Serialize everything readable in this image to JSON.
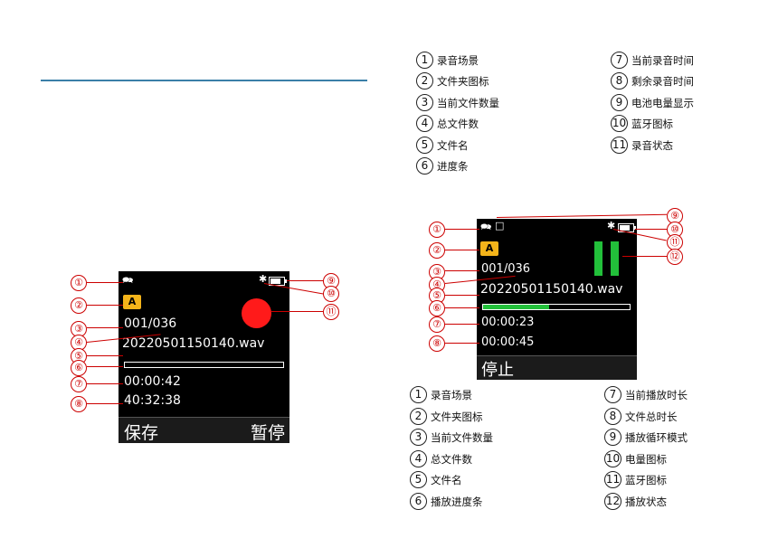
{
  "left_screen": {
    "scene_icon": "scene-icon",
    "folder_letter": "A",
    "file_count": "001/036",
    "file_name": "20220501150140.wav",
    "current_time": "00:00:42",
    "remaining_time": "40:32:38",
    "btn_left": "保存",
    "btn_right": "暂停",
    "record_color": "#ff1a1a",
    "callouts": [
      "①",
      "②",
      "③",
      "④",
      "⑤",
      "⑥",
      "⑦",
      "⑧",
      "⑨",
      "⑩",
      "⑪"
    ]
  },
  "record_legend": {
    "left": [
      {
        "num": "1",
        "label": "录音场景"
      },
      {
        "num": "2",
        "label": "文件夹图标"
      },
      {
        "num": "3",
        "label": "当前文件数量"
      },
      {
        "num": "4",
        "label": "总文件数"
      },
      {
        "num": "5",
        "label": "文件名"
      },
      {
        "num": "6",
        "label": "进度条"
      }
    ],
    "right": [
      {
        "num": "7",
        "label": "当前录音时间"
      },
      {
        "num": "8",
        "label": "剩余录音时间"
      },
      {
        "num": "9",
        "label": "电池电量显示"
      },
      {
        "num": "10",
        "label": "蓝牙图标"
      },
      {
        "num": "11",
        "label": "录音状态"
      }
    ]
  },
  "right_screen": {
    "folder_letter": "A",
    "file_count": "001/036",
    "file_name": "20220501150140.wav",
    "current_time": "00:00:23",
    "total_time": "00:00:45",
    "btn_left": "停止",
    "progress": 0.45,
    "play_color": "#22c03a",
    "callouts": [
      "①",
      "②",
      "③",
      "④",
      "⑤",
      "⑥",
      "⑦",
      "⑧",
      "⑨",
      "⑩",
      "⑪",
      "⑫"
    ]
  },
  "play_legend": {
    "left": [
      {
        "num": "1",
        "label": "录音场景"
      },
      {
        "num": "2",
        "label": "文件夹图标"
      },
      {
        "num": "3",
        "label": "当前文件数量"
      },
      {
        "num": "4",
        "label": "总文件数"
      },
      {
        "num": "5",
        "label": "文件名"
      },
      {
        "num": "6",
        "label": "播放进度条"
      }
    ],
    "right": [
      {
        "num": "7",
        "label": "当前播放时长"
      },
      {
        "num": "8",
        "label": "文件总时长"
      },
      {
        "num": "9",
        "label": "播放循环模式"
      },
      {
        "num": "10",
        "label": "电量图标"
      },
      {
        "num": "11",
        "label": "蓝牙图标"
      },
      {
        "num": "12",
        "label": "播放状态"
      }
    ]
  }
}
